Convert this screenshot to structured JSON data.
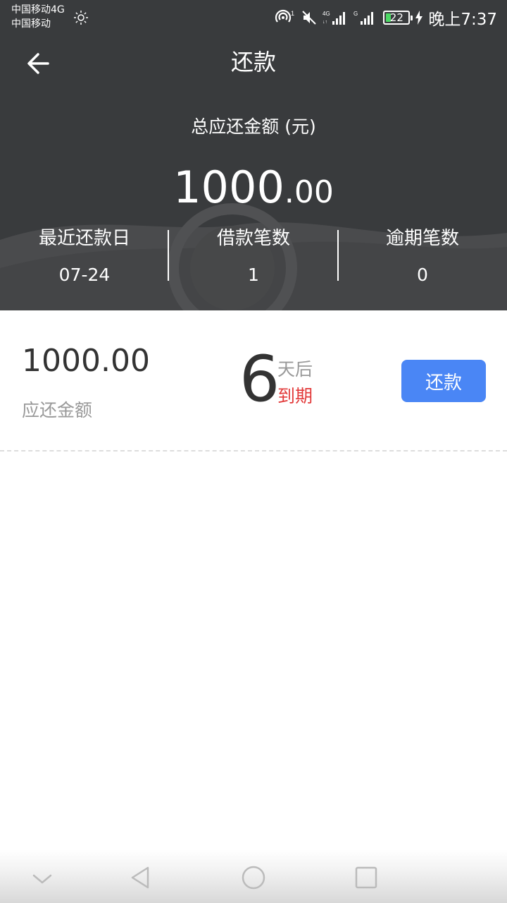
{
  "status_bar": {
    "carrier_line1": "中国移动4G",
    "carrier_line2": "中国移动",
    "battery_level": "22",
    "battery_percent": 22,
    "time": "晚上7:37"
  },
  "nav": {
    "title": "还款"
  },
  "summary": {
    "total_label": "总应还金额 (元)",
    "total_amount_integer": "1000",
    "total_amount_decimal": ".00",
    "stats": [
      {
        "label": "最近还款日",
        "value": "07-24"
      },
      {
        "label": "借款笔数",
        "value": "1"
      },
      {
        "label": "逾期笔数",
        "value": "0"
      }
    ]
  },
  "loan": {
    "amount": "1000.00",
    "amount_label": "应还金额",
    "days": "6",
    "days_suffix": "天后",
    "due_label": "到期",
    "repay_button": "还款"
  },
  "colors": {
    "header_bg": "#393b3d",
    "button_bg": "#4a86f5",
    "due_red": "#e23a3a",
    "battery_green": "#4cd964"
  }
}
